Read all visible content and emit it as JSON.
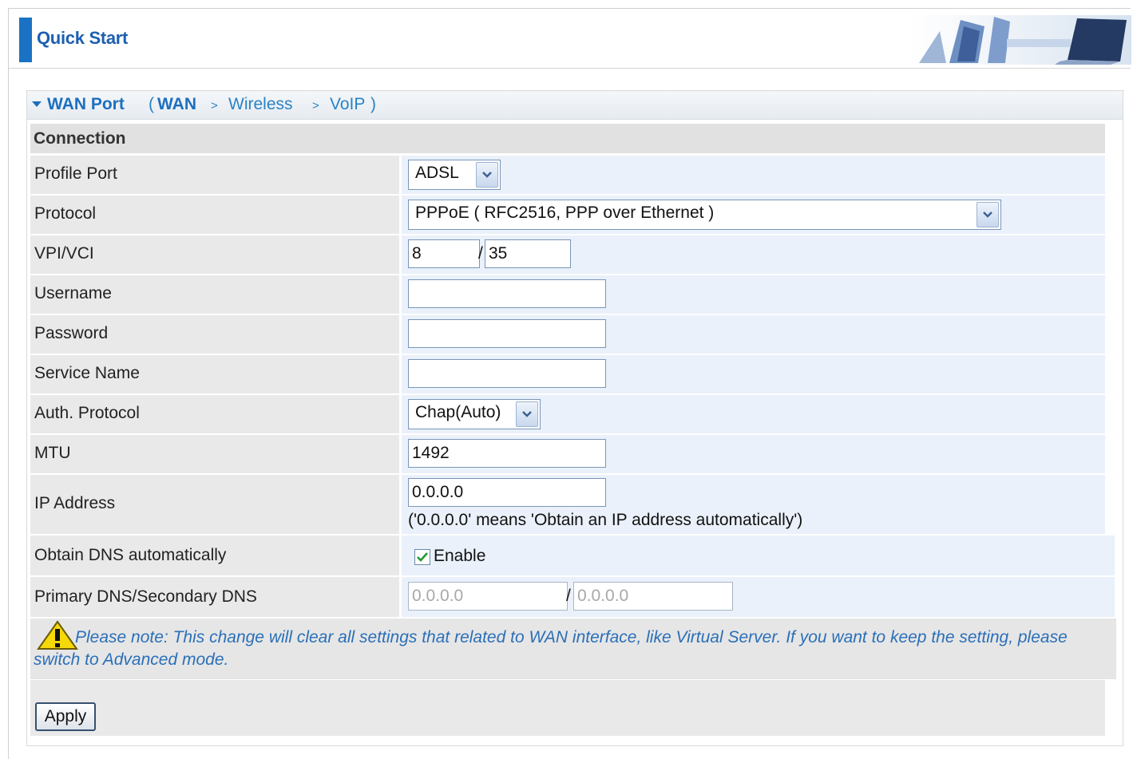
{
  "header": {
    "title": "Quick Start"
  },
  "breadcrumb": {
    "current": "WAN Port",
    "open_paren": "(",
    "steps": [
      "WAN",
      "Wireless",
      "VoIP"
    ],
    "separator": ">",
    "close_paren": ")"
  },
  "section_title": "Connection",
  "fields": {
    "profile_port": {
      "label": "Profile Port",
      "value": "ADSL"
    },
    "protocol": {
      "label": "Protocol",
      "value": "PPPoE ( RFC2516, PPP over Ethernet )"
    },
    "vpi_vci": {
      "label": "VPI/VCI",
      "vpi": "8",
      "vci": "35",
      "separator": "/"
    },
    "username": {
      "label": "Username",
      "value": ""
    },
    "password": {
      "label": "Password",
      "value": ""
    },
    "service_name": {
      "label": "Service Name",
      "value": ""
    },
    "auth_protocol": {
      "label": "Auth. Protocol",
      "value": "Chap(Auto)"
    },
    "mtu": {
      "label": "MTU",
      "value": "1492"
    },
    "ip_address": {
      "label": "IP Address",
      "value": "0.0.0.0",
      "hint": "('0.0.0.0' means 'Obtain an IP address automatically')"
    },
    "obtain_dns": {
      "label": "Obtain DNS automatically",
      "checkbox_label": "Enable",
      "checked": true
    },
    "dns": {
      "label": "Primary DNS/Secondary DNS",
      "primary": "0.0.0.0",
      "secondary": "0.0.0.0",
      "separator": "/"
    }
  },
  "note": "Please note: This change will clear all settings that related to WAN interface, like Virtual Server. If you want to keep the setting, please switch to Advanced mode.",
  "apply_label": "Apply",
  "colors": {
    "accent": "#1b72c4",
    "link": "#2a82c6",
    "label_bg": "#e9e9e9",
    "value_bg": "#eaf1fa"
  },
  "icons": [
    "header-graphic",
    "breadcrumb-arrow-icon",
    "dropdown-arrow-icon",
    "checkmark-icon",
    "warning-icon"
  ]
}
